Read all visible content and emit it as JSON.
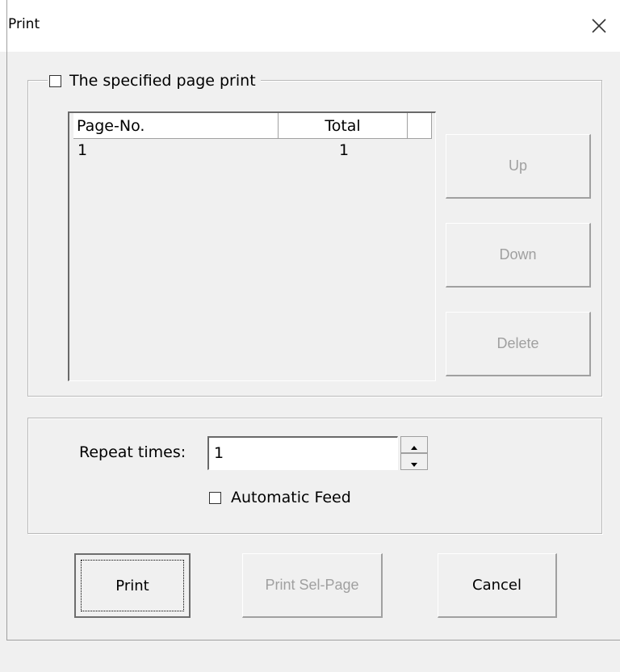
{
  "window": {
    "title": "Print"
  },
  "specified_page_group": {
    "checkbox_label": "The specified page print",
    "checked": false
  },
  "page_list": {
    "columns": [
      "Page-No.",
      "Total",
      ""
    ],
    "rows": [
      {
        "page_no": "1",
        "total": "1"
      }
    ]
  },
  "side_buttons": {
    "up": "Up",
    "down": "Down",
    "delete": "Delete"
  },
  "repeat": {
    "label": "Repeat times:",
    "value": "1"
  },
  "automatic_feed": {
    "label": "Automatic Feed",
    "checked": false
  },
  "footer_buttons": {
    "print": "Print",
    "print_sel_page": "Print Sel-Page",
    "cancel": "Cancel"
  },
  "colors": {
    "dialog_bg": "#f0f0f0",
    "disabled_text": "#a0a0a0",
    "titlebar_bg": "#ffffff"
  },
  "icons": {
    "close": "close-icon",
    "spin_up": "spin-up-arrow-icon",
    "spin_down": "spin-down-arrow-icon"
  }
}
